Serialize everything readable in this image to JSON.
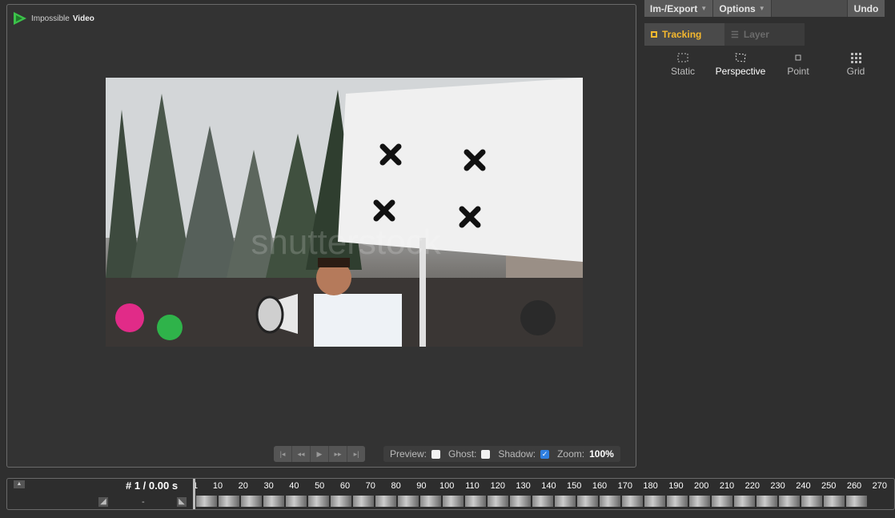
{
  "app": {
    "logo_text_prefix": "Impossible",
    "logo_text_bold": "Video"
  },
  "menus": {
    "import_export": "Im-/Export",
    "options": "Options",
    "undo": "Undo"
  },
  "tabs": {
    "tracking": "Tracking",
    "layer": "Layer"
  },
  "track_types": [
    "Static",
    "Perspective",
    "Point",
    "Grid"
  ],
  "video": {
    "watermark": "shutterstock"
  },
  "viewer_controls": {
    "preview_label": "Preview:",
    "preview_checked": false,
    "ghost_label": "Ghost:",
    "ghost_checked": false,
    "shadow_label": "Shadow:",
    "shadow_checked": true,
    "zoom_label": "Zoom:",
    "zoom_value": "100%"
  },
  "timeline": {
    "frame_readout": "# 1 / 0.00 s",
    "dash": "-",
    "ticks": [
      "1",
      "10",
      "20",
      "30",
      "40",
      "50",
      "60",
      "70",
      "80",
      "90",
      "100",
      "110",
      "120",
      "130",
      "140",
      "150",
      "160",
      "170",
      "180",
      "190",
      "200",
      "210",
      "220",
      "230",
      "240",
      "250",
      "260",
      "270"
    ]
  },
  "colors": {
    "accent": "#f5b82e",
    "background": "#2f2f2f",
    "checkbox_on": "#2f7fe0"
  }
}
